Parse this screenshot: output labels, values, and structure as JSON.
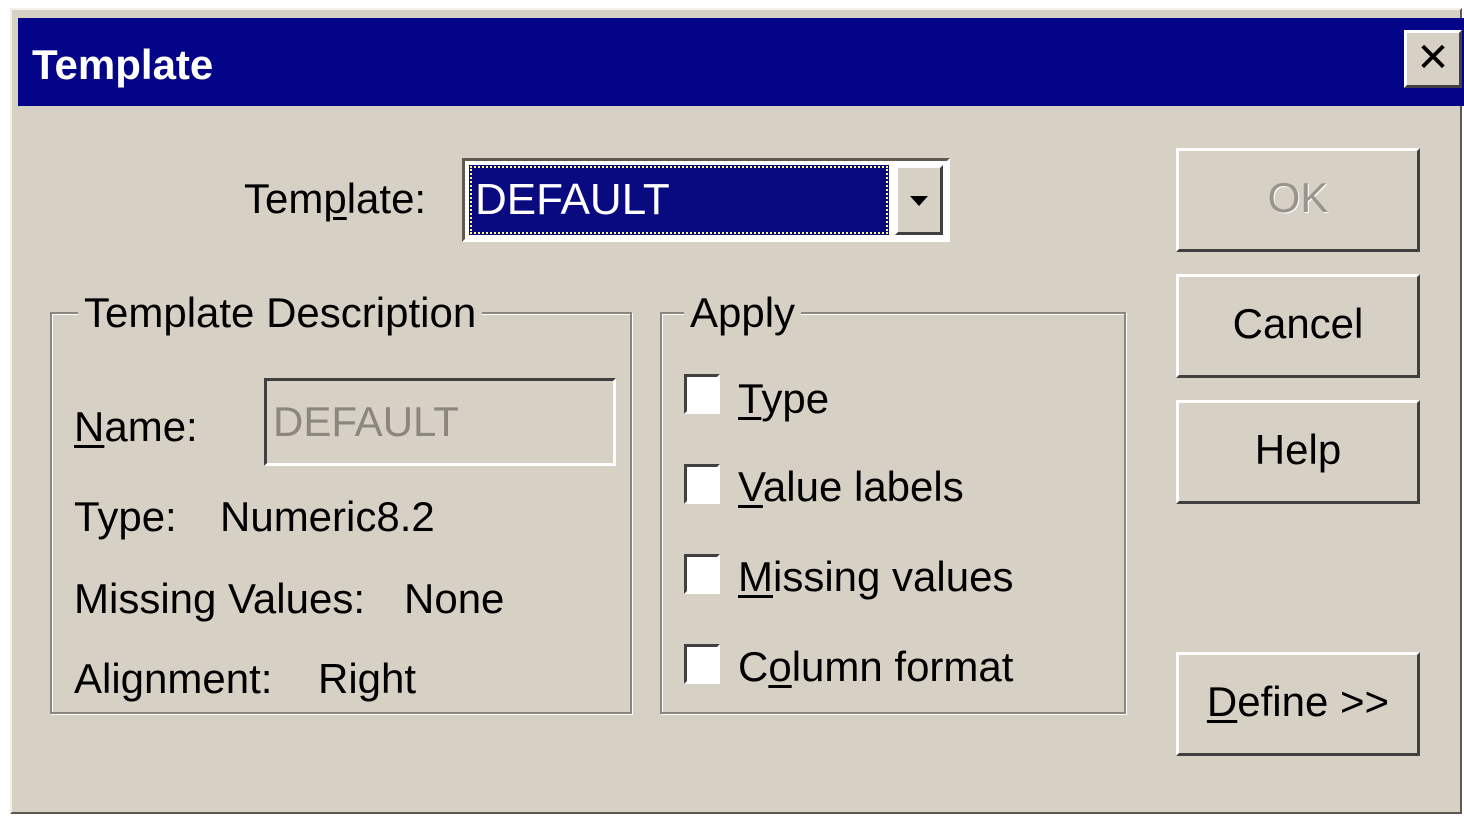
{
  "window": {
    "title": "Template",
    "close_glyph": "✕"
  },
  "template_select": {
    "label": "Template:",
    "value": "DEFAULT"
  },
  "description": {
    "title": "Template Description",
    "name_label": "Name:",
    "name_value": "DEFAULT",
    "type_label": "Type:",
    "type_value": "Numeric8.2",
    "missing_label": "Missing Values:",
    "missing_value": "None",
    "alignment_label": "Alignment:",
    "alignment_value": "Right"
  },
  "apply": {
    "title": "Apply",
    "options": [
      {
        "label": "Type",
        "checked": false
      },
      {
        "label": "Value labels",
        "checked": false
      },
      {
        "label": "Missing values",
        "checked": false
      },
      {
        "label": "Column format",
        "checked": false
      }
    ]
  },
  "buttons": {
    "ok": "OK",
    "cancel": "Cancel",
    "help": "Help",
    "define": "Define >>"
  },
  "colors": {
    "titlebar": "#040488",
    "face": "#d6d0c5",
    "selection": "#0a0a80"
  }
}
